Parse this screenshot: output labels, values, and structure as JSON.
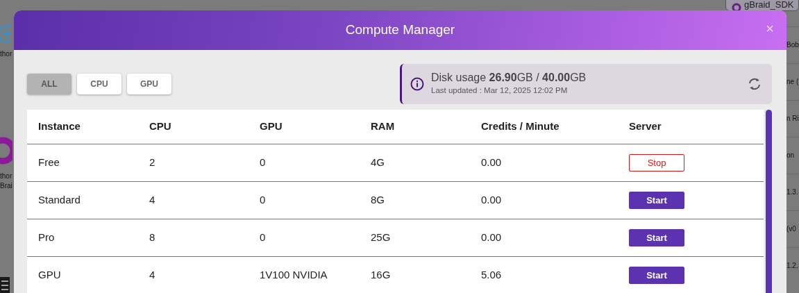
{
  "backdrop": {
    "left_labels": [
      "thor",
      "thor",
      "Brai"
    ],
    "right_tab": "gBraid_SDK",
    "right_items": [
      "Bob",
      "ne (",
      "n Ri",
      "on",
      "1.3.",
      "(v0",
      "1.2."
    ]
  },
  "dialog": {
    "title": "Compute Manager",
    "close": "×"
  },
  "filters": [
    {
      "label": "ALL",
      "selected": true
    },
    {
      "label": "CPU",
      "selected": false
    },
    {
      "label": "GPU",
      "selected": false
    }
  ],
  "disk": {
    "text": "Disk usage **26.90**GB / **40.00**GB",
    "updated": "Last updated : Mar 12, 2025 12:02 PM"
  },
  "table": {
    "columns": [
      "Instance",
      "CPU",
      "GPU",
      "RAM",
      "Credits / Minute",
      "Server"
    ],
    "rows": [
      {
        "cells": [
          "Free",
          "2",
          "0",
          "4G",
          "0.00"
        ],
        "action": {
          "label": "Stop",
          "kind": "stop"
        }
      },
      {
        "cells": [
          "Standard",
          "4",
          "0",
          "8G",
          "0.00"
        ],
        "action": {
          "label": "Start",
          "kind": "start"
        }
      },
      {
        "cells": [
          "Pro",
          "8",
          "0",
          "25G",
          "0.00"
        ],
        "action": {
          "label": "Start",
          "kind": "start"
        }
      },
      {
        "cells": [
          "GPU",
          "4",
          "1V100 NVIDIA",
          "16G",
          "5.06"
        ],
        "action": {
          "label": "Start",
          "kind": "start"
        }
      }
    ]
  }
}
